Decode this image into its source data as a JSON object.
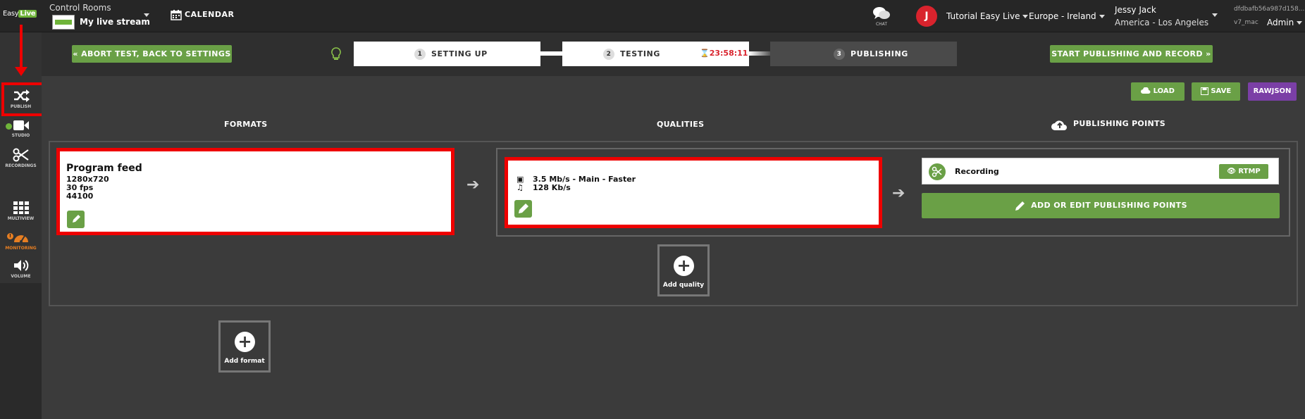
{
  "topbar": {
    "logo": {
      "part1": "Easy",
      "part2": "Live"
    },
    "control_rooms_label": "Control Rooms",
    "stream_name": "My live stream",
    "calendar_label": "CALENDAR",
    "chat_label": "CHAT",
    "avatar_letter": "J",
    "tutorial_label": "Tutorial Easy Live",
    "region_label": "Europe - Ireland",
    "user_name": "Jessy Jack",
    "user_timezone": "America - Los Angeles",
    "version_hash": "dfdbafb56a987d158...",
    "version_tag": "v7_mac",
    "role_label": "Admin"
  },
  "sidebar": {
    "items": [
      {
        "label": "PUBLISH",
        "icon": "shuffle-icon"
      },
      {
        "label": "STUDIO",
        "icon": "video-camera-icon"
      },
      {
        "label": "RECORDINGS",
        "icon": "scissors-icon"
      },
      {
        "label": "MULTIVIEW",
        "icon": "grid-icon"
      },
      {
        "label": "MONITORING",
        "icon": "gauge-icon"
      },
      {
        "label": "VOLUME",
        "icon": "volume-icon"
      }
    ],
    "warning_mark": "!"
  },
  "steps": {
    "abort_label": "«  ABORT TEST, BACK TO SETTINGS",
    "start_label": "START PUBLISHING AND RECORD  »",
    "items": [
      {
        "num": "1",
        "label": "SETTING UP"
      },
      {
        "num": "2",
        "label": "TESTING"
      },
      {
        "num": "3",
        "label": "PUBLISHING"
      }
    ],
    "timer": "23:58:11"
  },
  "toolbar": {
    "load": "LOAD",
    "save": "SAVE",
    "rawjson": "RAWJSON"
  },
  "columns": {
    "formats": "FORMATS",
    "qualities": "QUALITIES",
    "publishing_points": "PUBLISHING POINTS"
  },
  "format": {
    "title": "Program feed",
    "resolution": "1280x720",
    "fps": "30 fps",
    "audio_rate": "44100"
  },
  "quality": {
    "video": "3.5 Mb/s  -  Main  -  Faster",
    "audio": "128 Kb/s"
  },
  "publishing": {
    "recording": "Recording",
    "rtmp": "RTMP",
    "add_edit": "ADD OR EDIT PUBLISHING POINTS"
  },
  "add_quality": "Add quality",
  "add_format": "Add format",
  "colors": {
    "accent_green": "#6aa046",
    "highlight_red": "#e00000",
    "purple": "#7b3fa6",
    "timer_red": "#d9232d"
  }
}
